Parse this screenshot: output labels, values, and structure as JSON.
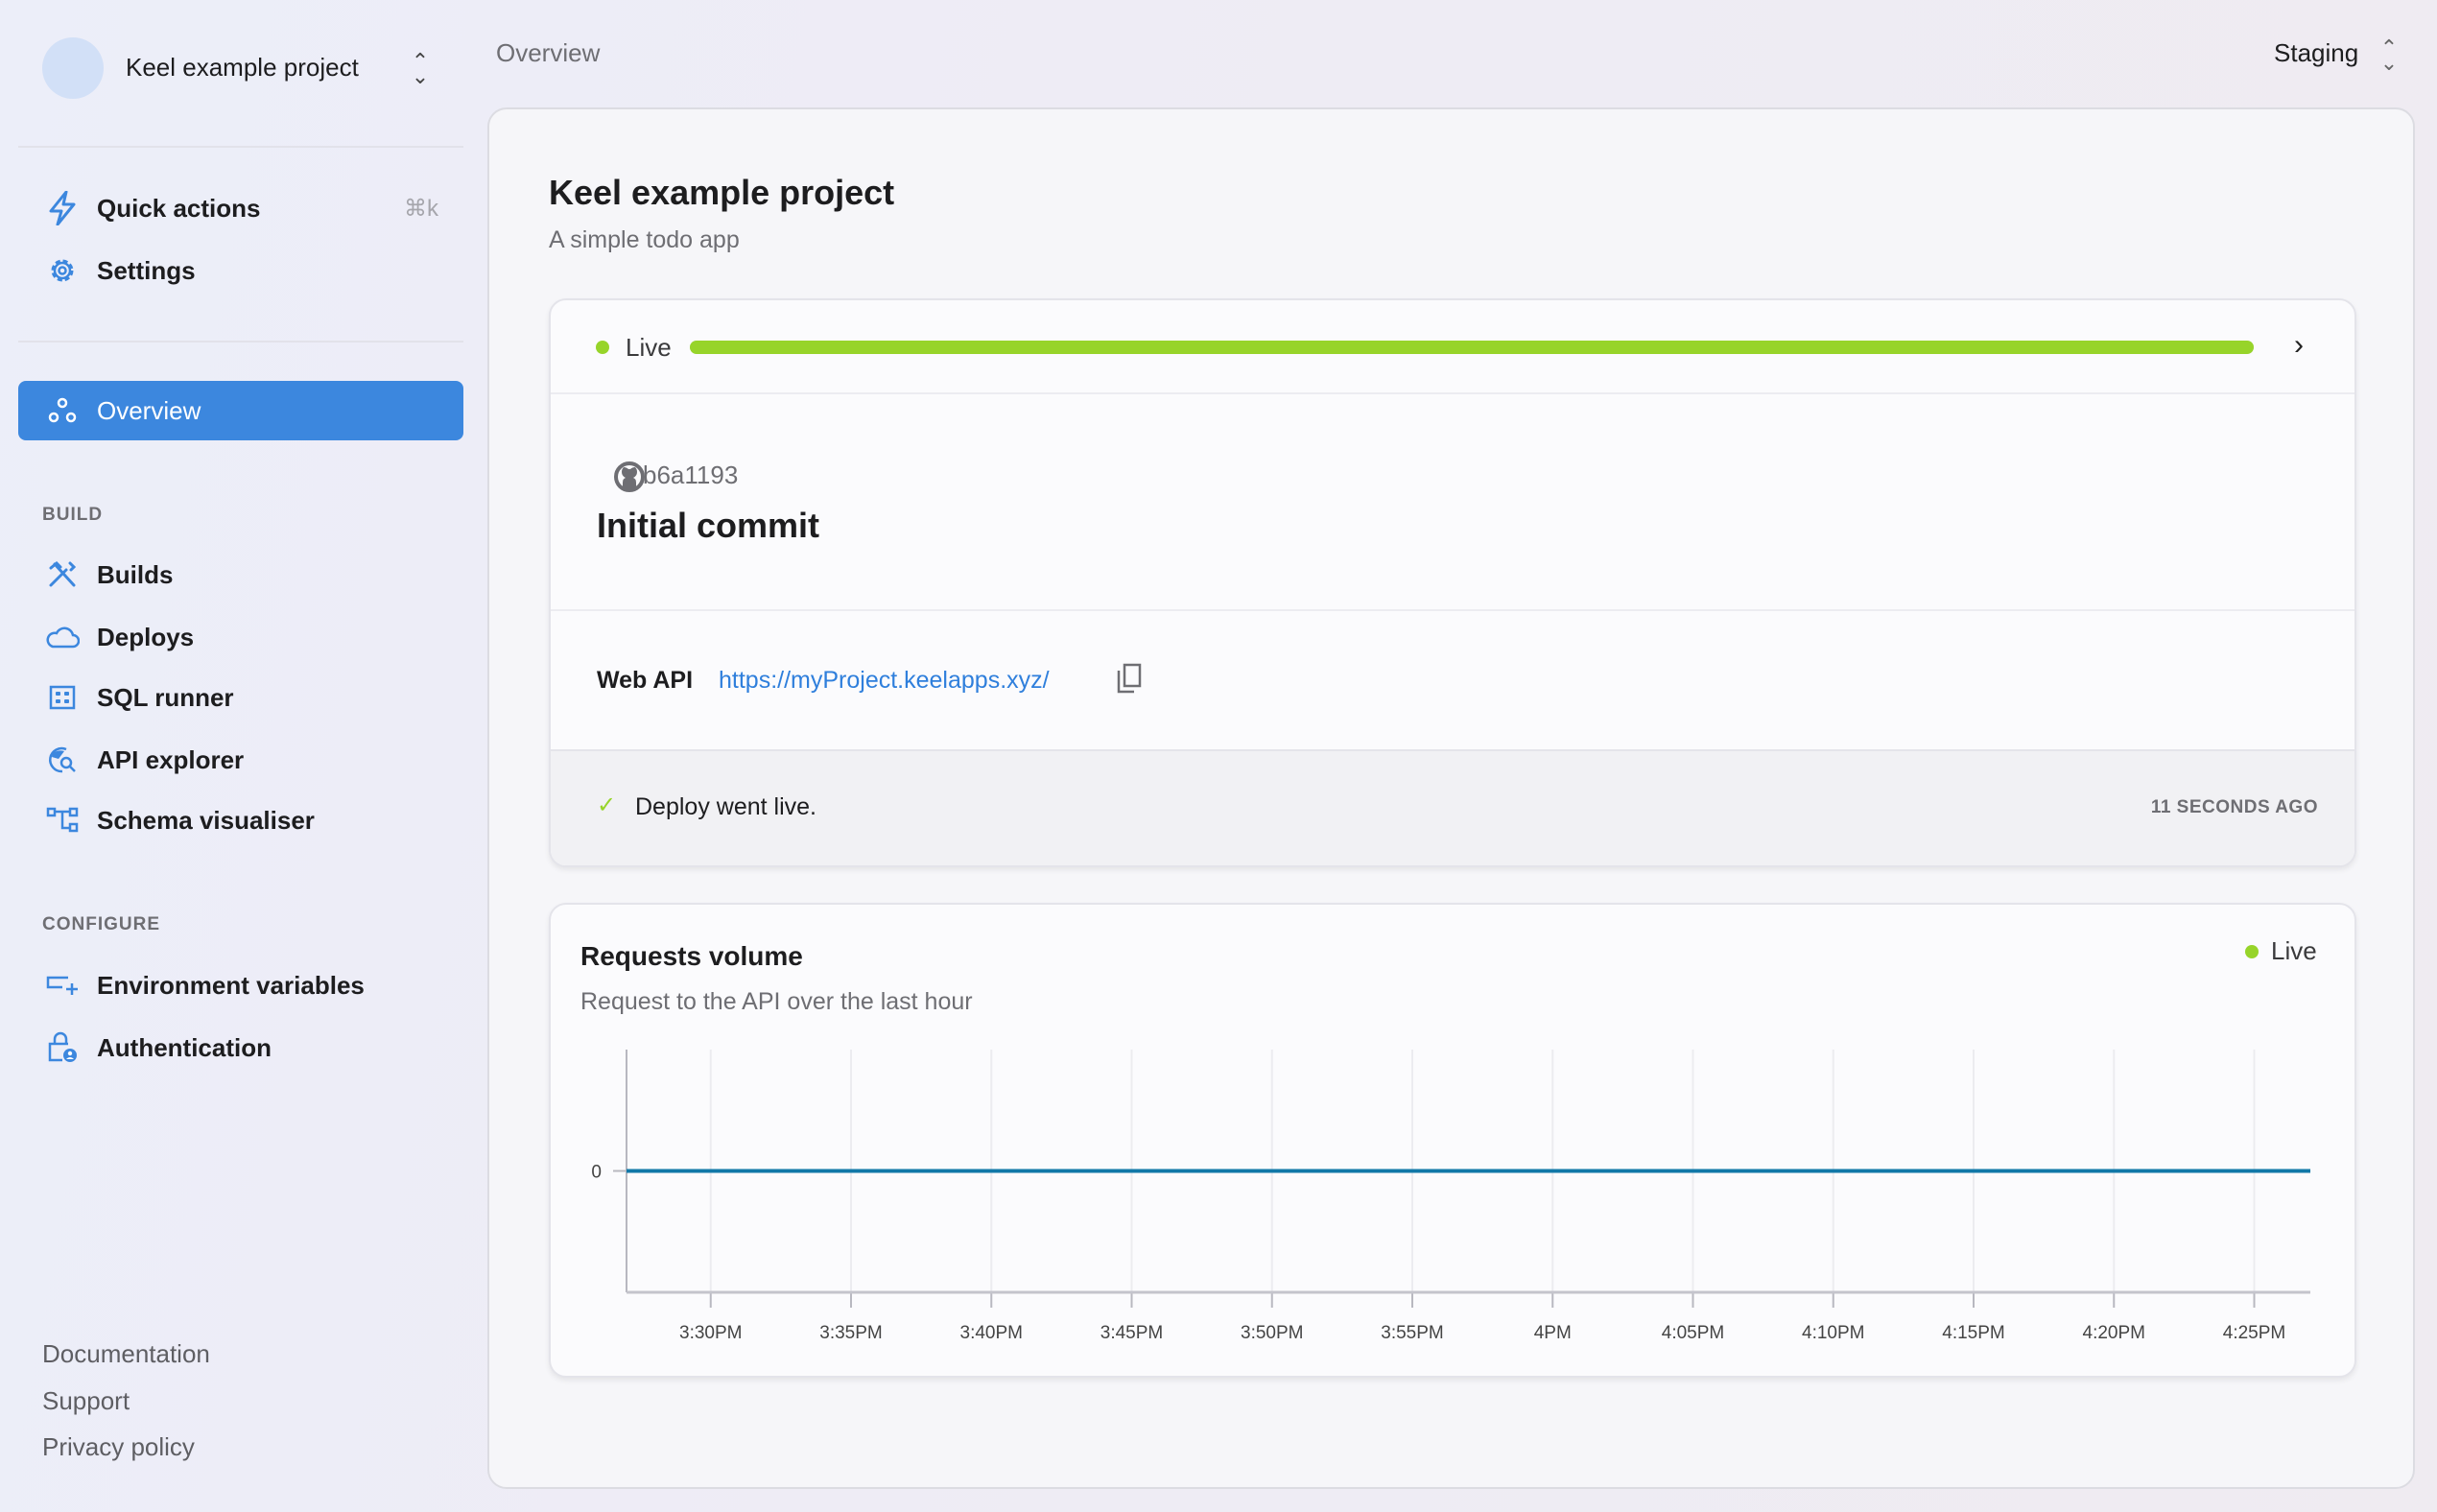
{
  "sidebar": {
    "project_name": "Keel example project",
    "quick_actions": {
      "label": "Quick actions",
      "shortcut": "⌘k"
    },
    "settings": {
      "label": "Settings"
    },
    "overview": {
      "label": "Overview"
    },
    "build_section": "BUILD",
    "build_items": [
      {
        "label": "Builds",
        "icon": "tools-icon"
      },
      {
        "label": "Deploys",
        "icon": "cloud-icon"
      },
      {
        "label": "SQL runner",
        "icon": "grid-icon"
      },
      {
        "label": "API explorer",
        "icon": "globe-search-icon"
      },
      {
        "label": "Schema visualiser",
        "icon": "schema-icon"
      }
    ],
    "configure_section": "CONFIGURE",
    "configure_items": [
      {
        "label": "Environment variables",
        "icon": "env-variables-icon"
      },
      {
        "label": "Authentication",
        "icon": "lock-user-icon"
      }
    ],
    "footer_links": [
      "Documentation",
      "Support",
      "Privacy policy"
    ]
  },
  "header": {
    "title": "Overview",
    "environment": "Staging"
  },
  "main": {
    "title": "Keel example project",
    "subtitle": "A simple todo app",
    "deploy": {
      "status": "Live",
      "progress": 1.0,
      "commit_hash": "b6a1193",
      "commit_message": "Initial commit",
      "web_api_label": "Web API",
      "web_api_url": "https://myProject.keelapps.xyz/",
      "event": "Deploy went live.",
      "time_ago": "11 SECONDS AGO"
    },
    "requests": {
      "title": "Requests volume",
      "subtitle": "Request to the API over the last hour",
      "status": "Live"
    }
  },
  "colors": {
    "accent": "#3c87de",
    "live": "#97d42a",
    "line": "#1178a8",
    "link": "#2f7fdc"
  },
  "chart_data": {
    "type": "line",
    "x_ticks": [
      "3:30PM",
      "3:35PM",
      "3:40PM",
      "3:45PM",
      "3:50PM",
      "3:55PM",
      "4PM",
      "4:05PM",
      "4:10PM",
      "4:15PM",
      "4:20PM",
      "4:25PM"
    ],
    "y_ticks": [
      0
    ],
    "xlim": [
      "3:27PM",
      "4:27PM"
    ],
    "ylim": [
      -1,
      1
    ],
    "grid": "vertical",
    "series": [
      {
        "x": [
          "3:27PM",
          "4:27PM"
        ],
        "y": [
          0,
          0
        ]
      }
    ]
  }
}
